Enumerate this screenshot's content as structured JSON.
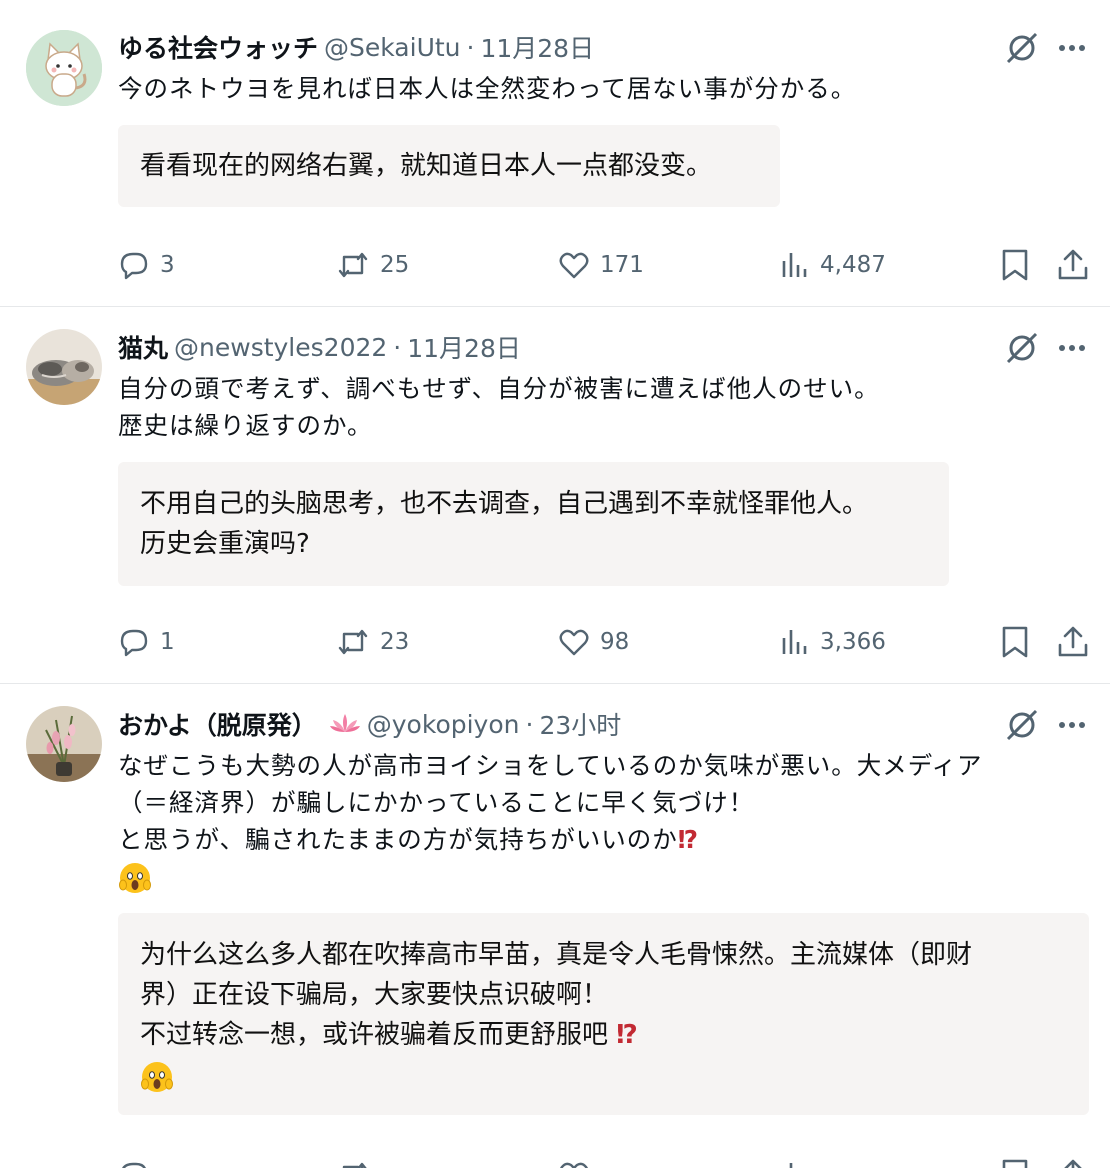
{
  "posts": [
    {
      "name": "ゆる社会ウォッチ",
      "handle": "@SekaiUtu",
      "separator": "·",
      "time": "11月28日",
      "lines": [
        "今のネトウヨを見れば日本人は全然変わって居ない事が分かる。"
      ],
      "translation": [
        "看看现在的网络右翼，就知道日本人一点都没变。"
      ],
      "stats": {
        "replies": "3",
        "reposts": "25",
        "likes": "171",
        "views": "4,487"
      }
    },
    {
      "name": "猫丸",
      "handle": "@newstyles2022",
      "separator": "·",
      "time": "11月28日",
      "lines": [
        "自分の頭で考えず、調べもせず、自分が被害に遭えば他人のせい。",
        "歴史は繰り返すのか。"
      ],
      "translation": [
        "不用自己的头脑思考，也不去调查，自己遇到不幸就怪罪他人。",
        "历史会重演吗?"
      ],
      "stats": {
        "replies": "1",
        "reposts": "23",
        "likes": "98",
        "views": "3,366"
      }
    },
    {
      "name": "おかよ（脱原発）",
      "handle": "@yokopiyon",
      "separator": "·",
      "time": "23小时",
      "lines": [
        "なぜこうも大勢の人が高市ヨイショをしているのか気味が悪い。大メディア",
        "（＝経済界）が騙しにかかっていることに早く気づけ！",
        "と思うが、騙されたままの方が気持ちがいいのか"
      ],
      "line_emoji": "⁉",
      "translation": [
        "为什么这么多人都在吹捧高市早苗，真是令人毛骨悚然。主流媒体（即财",
        "界）正在设下骗局，大家要快点识破啊！",
        "不过转念一想，或许被骗着反而更舒服吧"
      ],
      "translation_emoji": "⁉",
      "emoji": "scream-emoji"
    }
  ],
  "colors": {
    "text": "#0f1419",
    "secondary": "#536471",
    "translation_bg": "#f6f4f3",
    "divider": "#e6e8ea",
    "exclaim": "#c22a33"
  },
  "icons": [
    "reply-icon",
    "repost-icon",
    "like-icon",
    "views-icon",
    "bookmark-icon",
    "share-icon",
    "grok-icon",
    "more-icon"
  ]
}
